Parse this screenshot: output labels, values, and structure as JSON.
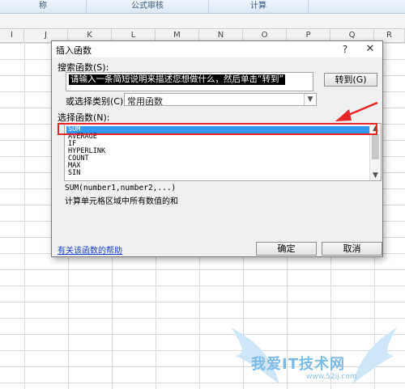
{
  "excel": {
    "ribbon_groups": [
      {
        "label": "称"
      },
      {
        "label": "公式审核"
      },
      {
        "label": "计算"
      }
    ],
    "columns": [
      "I",
      "J",
      "K",
      "L",
      "M",
      "N",
      "O",
      "P",
      "Q",
      "R"
    ]
  },
  "dialog": {
    "title": "插入函数",
    "help_glyph": "?",
    "close_glyph": "✕",
    "search_label": "搜索函数(S):",
    "search_value": "请输入一条简短说明来描述您想做什么，然后单击“转到”",
    "go_button": "转到(G)",
    "category_label": "或选择类别(C):",
    "category_value": "常用函数",
    "function_label": "选择函数(N):",
    "functions": [
      "SUM",
      "AVERAGE",
      "IF",
      "HYPERLINK",
      "COUNT",
      "MAX",
      "SIN"
    ],
    "selected_function": "SUM",
    "syntax": "SUM(number1,number2,...)",
    "description": "计算单元格区域中所有数值的和",
    "help_link": "有关该函数的帮助",
    "ok_button": "确定",
    "cancel_button": "取消"
  },
  "colors": {
    "selection": "#3399ff",
    "annotation": "#e8262a",
    "link": "#1a3fd1"
  },
  "watermark": {
    "text": "我爱IT技术网",
    "url": "www.52ij.com"
  }
}
